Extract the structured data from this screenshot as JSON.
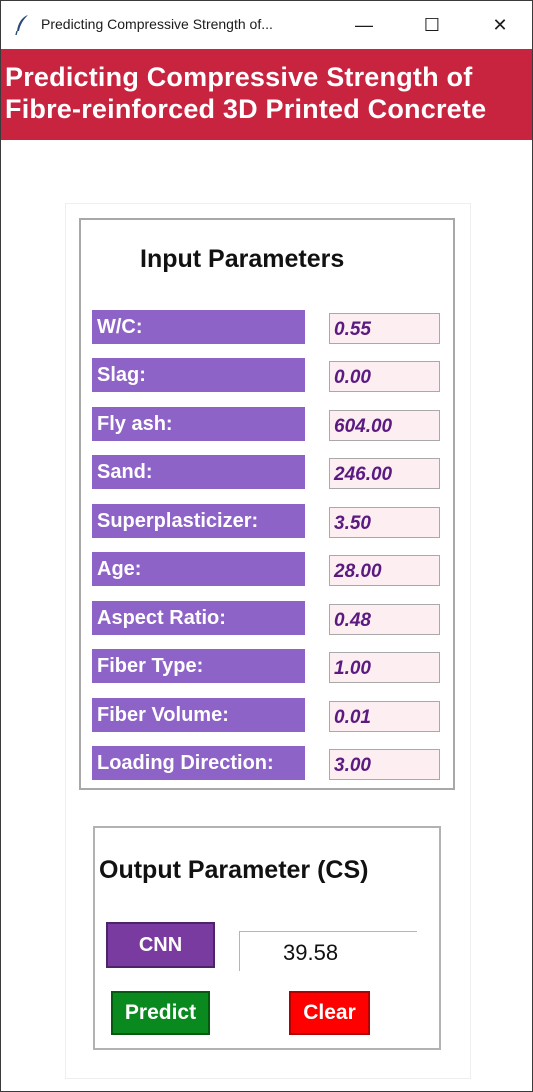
{
  "window": {
    "title": "Predicting Compressive Strength of...",
    "icon": "feather-icon",
    "controls": {
      "minimize": "—",
      "maximize": "☐",
      "close": "✕"
    }
  },
  "header": {
    "line1": "Predicting Compressive Strength of",
    "line2": "Fibre-reinforced 3D Printed Concrete",
    "color": "#c8233f"
  },
  "inputs": {
    "heading": "Input Parameters",
    "label_color": "#8e63c8",
    "fields": [
      {
        "label": "W/C:",
        "value": "0.55"
      },
      {
        "label": "Slag:",
        "value": "0.00"
      },
      {
        "label": "Fly ash:",
        "value": "604.00"
      },
      {
        "label": "Sand:",
        "value": "246.00"
      },
      {
        "label": "Superplasticizer:",
        "value": "3.50"
      },
      {
        "label": "Age:",
        "value": "28.00"
      },
      {
        "label": "Aspect Ratio:",
        "value": "0.48"
      },
      {
        "label": "Fiber Type:",
        "value": "1.00"
      },
      {
        "label": "Fiber Volume:",
        "value": "0.01"
      },
      {
        "label": "Loading Direction:",
        "value": "3.00"
      }
    ]
  },
  "output": {
    "heading": "Output Parameter (CS)",
    "model_label": "CNN",
    "result": "39.58",
    "predict_label": "Predict",
    "clear_label": "Clear",
    "predict_color": "#0a8a1e",
    "clear_color": "#ff0000",
    "model_color": "#7a3ba0"
  }
}
